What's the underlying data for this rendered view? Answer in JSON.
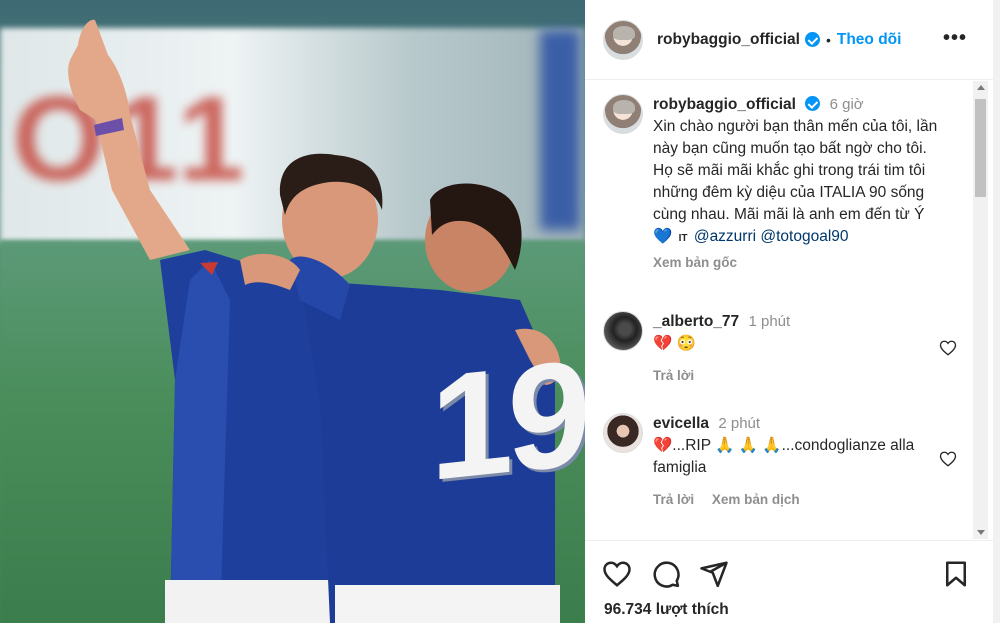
{
  "post": {
    "username": "robybaggio_official",
    "follow_label": "Theo dõi",
    "separator": "•",
    "more_label": "•••"
  },
  "caption": {
    "username": "robybaggio_official",
    "time": "6 giờ",
    "text": "Xin chào người bạn thân mến của tôi, lần này bạn cũng muốn tạo bất ngờ cho tôi. Họ sẽ mãi mãi khắc ghi trong trái tim tôi những đêm kỳ diệu của ITALIA 90 sống cùng nhau. Mãi mãi là anh em đến từ Ý 💙",
    "flag": "IT",
    "mention_1": "@azzurri",
    "mention_2": "@totogoal90",
    "see_original": "Xem bản gốc"
  },
  "comments": [
    {
      "username": "_alberto_77",
      "time": "1 phút",
      "text": "💔 😳",
      "reply": "Trả lời",
      "translate": ""
    },
    {
      "username": "evicella",
      "time": "2 phút",
      "text": "💔...RIP 🙏 🙏 🙏...condoglianze alla famiglia",
      "reply": "Trả lời",
      "translate": "Xem bản dịch"
    }
  ],
  "likes": "96.734 lượt thích",
  "image": {
    "jersey_number": "19"
  },
  "colors": {
    "accent": "#0095f6",
    "text": "#262626",
    "muted": "#8e8e8e",
    "mention": "#00376b"
  }
}
